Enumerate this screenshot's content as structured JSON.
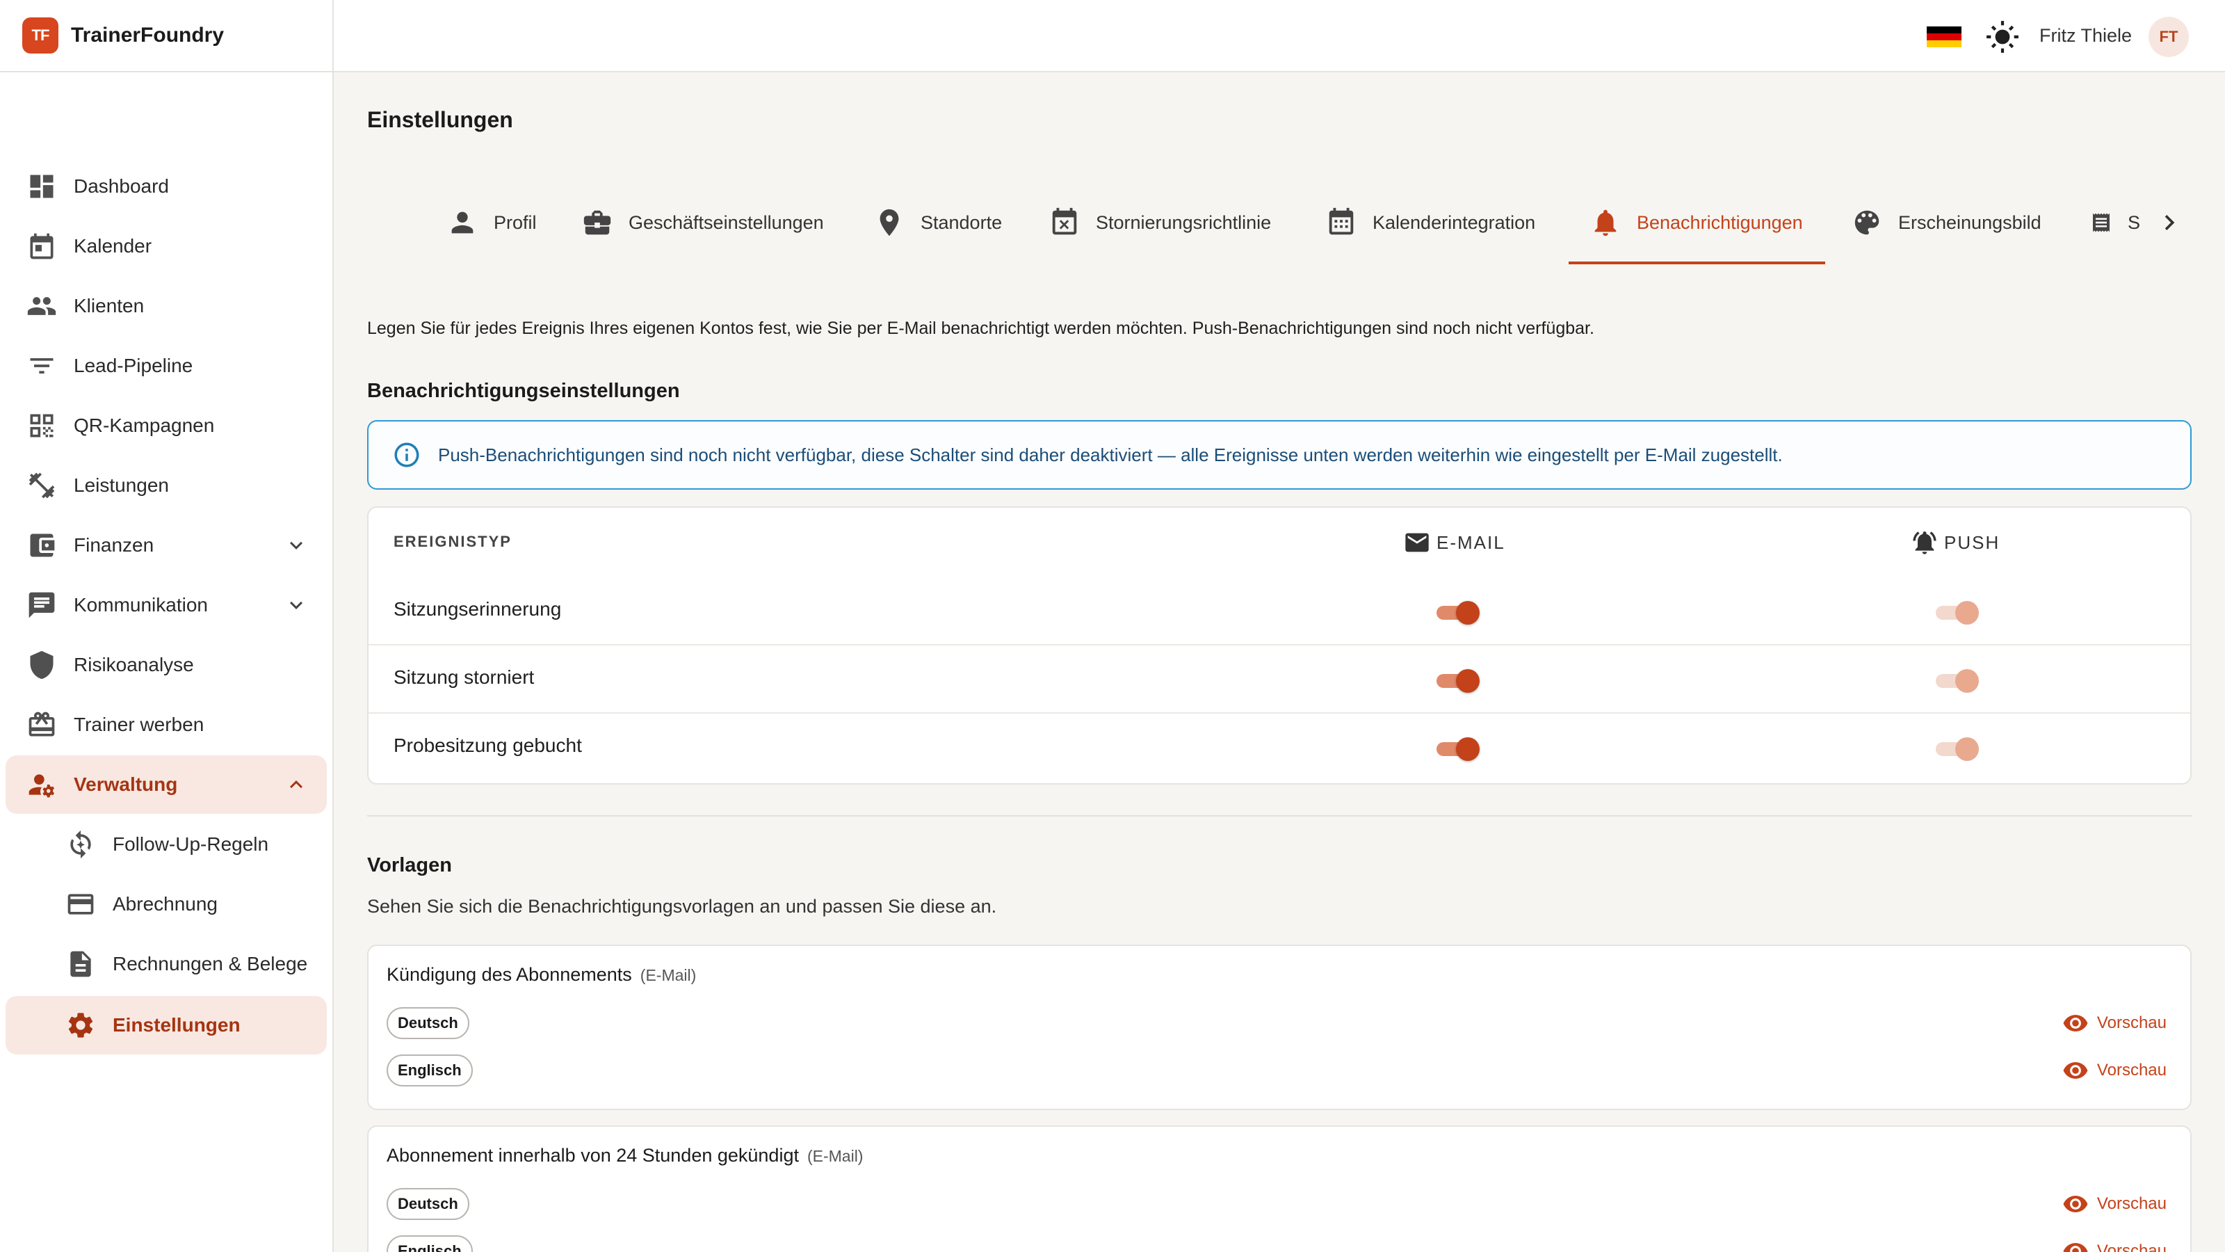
{
  "app": {
    "logo_text": "TF",
    "name": "TrainerFoundry"
  },
  "topbar": {
    "language_flag": "de-flag-icon",
    "theme_icon": "sun-icon",
    "user_name": "Fritz Thiele",
    "avatar_initials": "FT"
  },
  "sidebar": {
    "items": [
      {
        "label": "Dashboard",
        "icon": "dashboard-icon"
      },
      {
        "label": "Kalender",
        "icon": "calendar-icon"
      },
      {
        "label": "Klienten",
        "icon": "people-icon"
      },
      {
        "label": "Lead-Pipeline",
        "icon": "filter-icon"
      },
      {
        "label": "QR-Kampagnen",
        "icon": "qr-code-icon"
      },
      {
        "label": "Leistungen",
        "icon": "dumbbell-icon"
      },
      {
        "label": "Finanzen",
        "icon": "wallet-icon"
      },
      {
        "label": "Kommunikation",
        "icon": "chat-icon"
      },
      {
        "label": "Risikoanalyse",
        "icon": "shield-icon"
      },
      {
        "label": "Trainer werben",
        "icon": "gift-icon"
      },
      {
        "label": "Verwaltung",
        "icon": "admin-icon"
      },
      {
        "label": "Follow-Up-Regeln",
        "icon": "sync-icon"
      },
      {
        "label": "Abrechnung",
        "icon": "credit-card-icon"
      },
      {
        "label": "Rechnungen & Belege",
        "icon": "document-icon"
      },
      {
        "label": "Einstellungen",
        "icon": "gear-icon"
      }
    ]
  },
  "page": {
    "title": "Einstellungen"
  },
  "tabs": [
    {
      "label": "Profil",
      "icon": "person-icon"
    },
    {
      "label": "Geschäftseinstellungen",
      "icon": "briefcase-icon"
    },
    {
      "label": "Standorte",
      "icon": "location-pin-icon"
    },
    {
      "label": "Stornierungsrichtlinie",
      "icon": "calendar-cancel-icon"
    },
    {
      "label": "Kalenderintegration",
      "icon": "calendar-grid-icon"
    },
    {
      "label": "Benachrichtigungen",
      "icon": "bell-icon",
      "active": true
    },
    {
      "label": "Erscheinungsbild",
      "icon": "palette-icon"
    },
    {
      "label": "S",
      "icon": "receipt-icon"
    }
  ],
  "notifications": {
    "intro": "Legen Sie für jedes Ereignis Ihres eigenen Kontos fest, wie Sie per E-Mail benachrichtigt werden möchten. Push-Benachrichtigungen sind noch nicht verfügbar.",
    "section_title": "Benachrichtigungseinstellungen",
    "info": "Push-Benachrichtigungen sind noch nicht verfügbar, diese Schalter sind daher deaktiviert — alle Ereignisse unten werden weiterhin wie eingestellt per E-Mail zugestellt.",
    "table": {
      "col_event": "EREIGNISTYP",
      "col_email": "E-MAIL",
      "col_push": "PUSH",
      "rows": [
        {
          "label": "Sitzungserinnerung",
          "email": true,
          "push": true,
          "push_disabled": true
        },
        {
          "label": "Sitzung storniert",
          "email": true,
          "push": true,
          "push_disabled": true
        },
        {
          "label": "Probesitzung gebucht",
          "email": true,
          "push": true,
          "push_disabled": true
        }
      ]
    }
  },
  "templates": {
    "title": "Vorlagen",
    "subtitle": "Sehen Sie sich die Benachrichtigungsvorlagen an und passen Sie diese an.",
    "preview_label": "Vorschau",
    "items": [
      {
        "name": "Kündigung des Abonnements",
        "channel": "(E-Mail)",
        "languages": [
          "Deutsch",
          "Englisch"
        ]
      },
      {
        "name": "Abonnement innerhalb von 24 Stunden gekündigt",
        "channel": "(E-Mail)",
        "languages": [
          "Deutsch",
          "Englisch"
        ]
      }
    ]
  },
  "colors": {
    "accent": "#c4421a",
    "info_border": "#2f9bd3",
    "active_nav_bg": "#f8e8e1"
  }
}
